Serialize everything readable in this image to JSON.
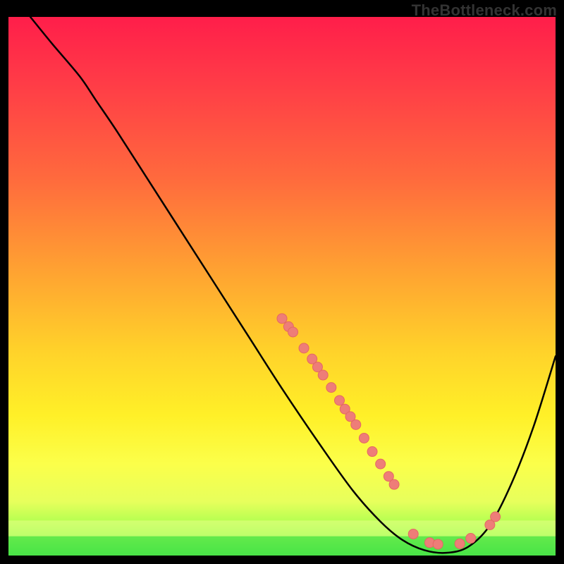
{
  "watermark": "TheBottleneck.com",
  "colors": {
    "curve_stroke": "#000000",
    "curve_stroke_width": 2.5,
    "dot_fill": "#ee7d78",
    "dot_outline": "#e46863",
    "dot_radius": 7,
    "band_top_color": "#1cdb31",
    "band_top_opacity": 0.55,
    "band_bot_color": "#f4ff95",
    "band_bot_opacity": 0.45,
    "gradient_stops": [
      {
        "offset": 0.0,
        "color": "#ff1e4a"
      },
      {
        "offset": 0.12,
        "color": "#ff3b47"
      },
      {
        "offset": 0.3,
        "color": "#ff6a3d"
      },
      {
        "offset": 0.48,
        "color": "#ffa531"
      },
      {
        "offset": 0.62,
        "color": "#ffd22a"
      },
      {
        "offset": 0.74,
        "color": "#fff028"
      },
      {
        "offset": 0.83,
        "color": "#fbff4a"
      },
      {
        "offset": 0.9,
        "color": "#e7ff5c"
      },
      {
        "offset": 0.96,
        "color": "#97ff4a"
      },
      {
        "offset": 1.0,
        "color": "#21e23a"
      }
    ]
  },
  "chart_data": {
    "type": "line",
    "title": "",
    "xlabel": "",
    "ylabel": "",
    "xlim": [
      0,
      100
    ],
    "ylim": [
      0,
      100
    ],
    "curve": [
      {
        "x": 4.0,
        "y": 100.0
      },
      {
        "x": 8.0,
        "y": 95.0
      },
      {
        "x": 13.0,
        "y": 89.0
      },
      {
        "x": 16.0,
        "y": 84.5
      },
      {
        "x": 20.0,
        "y": 78.5
      },
      {
        "x": 26.0,
        "y": 69.0
      },
      {
        "x": 32.0,
        "y": 59.5
      },
      {
        "x": 38.0,
        "y": 50.0
      },
      {
        "x": 44.0,
        "y": 40.5
      },
      {
        "x": 50.0,
        "y": 31.0
      },
      {
        "x": 57.0,
        "y": 20.5
      },
      {
        "x": 63.0,
        "y": 12.0
      },
      {
        "x": 68.0,
        "y": 6.3
      },
      {
        "x": 72.0,
        "y": 2.9
      },
      {
        "x": 76.0,
        "y": 1.0
      },
      {
        "x": 80.0,
        "y": 0.5
      },
      {
        "x": 84.0,
        "y": 1.6
      },
      {
        "x": 88.0,
        "y": 5.6
      },
      {
        "x": 92.0,
        "y": 13.5
      },
      {
        "x": 96.0,
        "y": 24.0
      },
      {
        "x": 100.0,
        "y": 37.0
      }
    ],
    "marker_points": [
      {
        "x": 50.0,
        "y": 44.0
      },
      {
        "x": 51.2,
        "y": 42.5
      },
      {
        "x": 52.0,
        "y": 41.5
      },
      {
        "x": 54.0,
        "y": 38.5
      },
      {
        "x": 55.5,
        "y": 36.5
      },
      {
        "x": 56.5,
        "y": 35.0
      },
      {
        "x": 57.5,
        "y": 33.5
      },
      {
        "x": 59.0,
        "y": 31.2
      },
      {
        "x": 60.5,
        "y": 28.8
      },
      {
        "x": 61.5,
        "y": 27.2
      },
      {
        "x": 62.5,
        "y": 25.8
      },
      {
        "x": 63.5,
        "y": 24.3
      },
      {
        "x": 65.0,
        "y": 21.8
      },
      {
        "x": 66.5,
        "y": 19.3
      },
      {
        "x": 68.0,
        "y": 17.0
      },
      {
        "x": 69.5,
        "y": 14.7
      },
      {
        "x": 70.5,
        "y": 13.2
      },
      {
        "x": 74.0,
        "y": 4.0
      },
      {
        "x": 77.0,
        "y": 2.4
      },
      {
        "x": 78.5,
        "y": 2.1
      },
      {
        "x": 82.5,
        "y": 2.2
      },
      {
        "x": 84.5,
        "y": 3.2
      },
      {
        "x": 88.0,
        "y": 5.7
      },
      {
        "x": 89.0,
        "y": 7.2
      }
    ],
    "optimal_band": {
      "y_min": 0,
      "y_max": 6.5
    }
  }
}
